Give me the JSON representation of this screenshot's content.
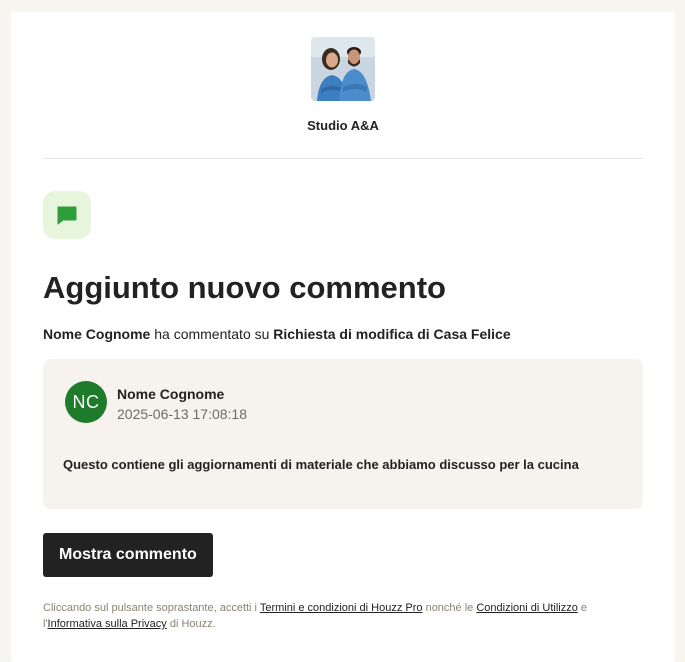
{
  "header": {
    "studio_name": "Studio A&A"
  },
  "main": {
    "title": "Aggiunto nuovo commento",
    "subtitle": {
      "author": "Nome Cognome",
      "middle": " ha commentato su ",
      "target": "Richiesta di modifica di Casa Felice"
    },
    "comment": {
      "initials": "NC",
      "author": "Nome Cognome",
      "date": "2025-06-13 17:08:18",
      "text": "Questo contiene gli aggiornamenti di materiale che abbiamo discusso per la cucina",
      "avatar_color": "#1e7b2c"
    },
    "button_label": "Mostra commento"
  },
  "legal": {
    "part1": "Cliccando sul pulsante soprastante, accetti i ",
    "link1": "Termini e condizioni di Houzz Pro",
    "part2": " nonché le ",
    "link2": "Condizioni di Utilizzo",
    "part3": " e l'",
    "link3": "Informativa sulla Privacy",
    "part4": " di Houzz."
  },
  "colors": {
    "accent_green": "#2e9e3a",
    "icon_bg": "#e6f5dc",
    "button_bg": "#222222",
    "comment_bg": "#f6f3ee"
  }
}
